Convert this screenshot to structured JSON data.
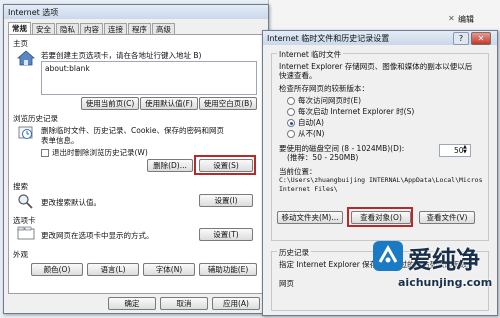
{
  "background": {
    "edit_label": "编辑",
    "edit_icon": "close-small-icon"
  },
  "left": {
    "title": "Internet 选项",
    "close": "✕",
    "tabs": [
      "常规",
      "安全",
      "隐私",
      "内容",
      "连接",
      "程序",
      "高级"
    ],
    "home": {
      "heading": "主页",
      "desc": "若要创建主页选项卡，请在各地址行键入地址 B)",
      "url": "about:blank",
      "btn_current": "使用当前页(C)",
      "btn_default": "使用默认值(F)",
      "btn_blank": "使用空白页(B)"
    },
    "history": {
      "heading": "浏览历史记录",
      "desc_line1": "删除临时文件、历史记录、Cookie、保存的密码和网页",
      "desc_line2": "表单信息。",
      "checkbox": "退出时删除浏览历史记录(W)",
      "btn_delete": "删除(D)...",
      "btn_settings": "设置(S)"
    },
    "search": {
      "heading": "搜索",
      "desc": "更改搜索默认值。",
      "btn": "设置(I)"
    },
    "tabs_section": {
      "heading": "选项卡",
      "desc": "更改网页在选项卡中显示的方式。",
      "btn": "设置(T)"
    },
    "appearance": {
      "heading": "外观",
      "btn_colors": "颜色(O)",
      "btn_language": "语言(L)",
      "btn_fonts": "字体(N)",
      "btn_access": "辅助功能(E)"
    },
    "footer": {
      "ok": "确定",
      "cancel": "取消",
      "apply": "应用(A)"
    },
    "highlight_color": "#b72a2a"
  },
  "right": {
    "title": "Internet 临时文件和历史记录设置",
    "help": "?",
    "close": "✕",
    "temp": {
      "heading": "Internet 临时文件",
      "desc_line1": "Internet Explorer 存储网页、图像和媒体的副本以便以后",
      "desc_line2": "快速查看。",
      "check_label": "检查所存网页的较新版本：",
      "options": [
        "每次访问网页时(E)",
        "每次启动 Internet Explorer 时(S)",
        "自动(A)",
        "从不(N)"
      ],
      "selected": "自动(A)",
      "space_label": "要使用的磁盘空间 (8 - 1024MB)(D):",
      "space_hint": "(推荐：50 - 250MB)",
      "space_value": "50",
      "location_label": "当前位置：",
      "location_line1": "C:\\Users\\zhuangbuijing INTERNAL\\AppData\\Local\\Micros",
      "location_line2": "Internet Files\\",
      "btn_move": "移动文件夹(M)...",
      "btn_objects": "查看对象(O)",
      "btn_files": "查看文件(V)"
    },
    "history": {
      "heading": "历史记录",
      "desc": "指定 Internet Explorer 保存您访问过的网站列表的天数。",
      "days_label": "网页"
    }
  },
  "watermark": {
    "name": "爱纯净",
    "url": "aichunjing.com"
  }
}
